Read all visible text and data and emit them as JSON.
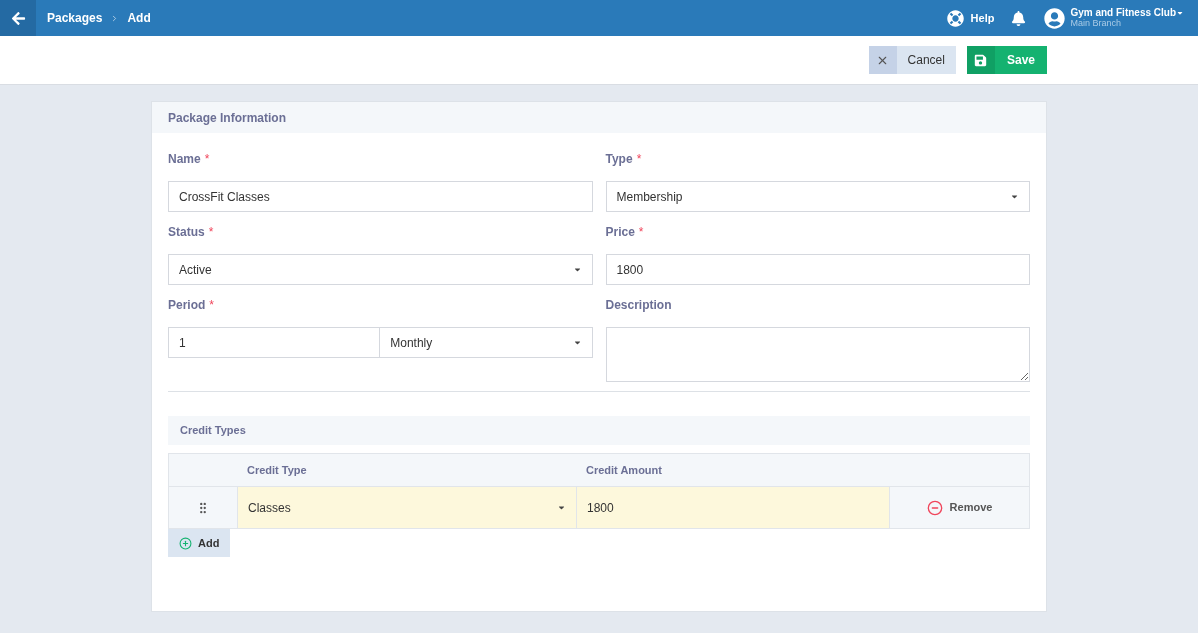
{
  "header": {
    "breadcrumb": [
      {
        "label": "Packages"
      },
      {
        "label": "Add"
      }
    ],
    "help": "Help",
    "account": {
      "name": "Gym and Fitness Club",
      "branch": "Main Branch"
    }
  },
  "actions": {
    "cancel": "Cancel",
    "save": "Save"
  },
  "panel": {
    "title": "Package Information",
    "fields": [
      {
        "label": "Name",
        "required_mark": "*",
        "kind": "text",
        "value": "CrossFit Classes"
      },
      {
        "label": "Type",
        "required_mark": "*",
        "kind": "select",
        "value": "Membership"
      },
      {
        "label": "Status",
        "required_mark": "*",
        "kind": "select",
        "value": "Active"
      },
      {
        "label": "Price",
        "required_mark": "*",
        "kind": "text",
        "value": "1800"
      },
      {
        "label": "Period",
        "required_mark": "*",
        "kind": "period",
        "value": "1",
        "unit": "Monthly"
      },
      {
        "label": "Description",
        "kind": "textarea"
      }
    ],
    "credit_types": {
      "title": "Credit Types",
      "columns": [
        "Credit Type",
        "Credit Amount"
      ],
      "rows": [
        {
          "credit_type": "Classes",
          "credit_amount": "1800",
          "remove": "Remove"
        }
      ],
      "add": "Add"
    }
  }
}
